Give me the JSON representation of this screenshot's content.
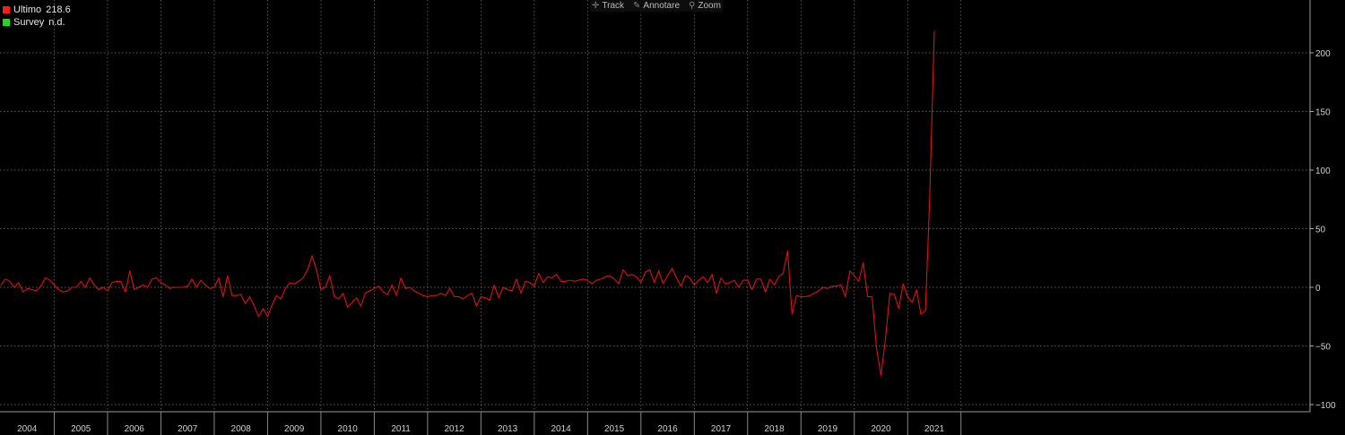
{
  "legend": [
    {
      "label": "Ultimo",
      "value": "218.6",
      "color": "#ff1a1a"
    },
    {
      "label": "Survey",
      "value": "n.d.",
      "color": "#18e018"
    }
  ],
  "toolbar": {
    "track": {
      "label": "Track",
      "icon": "crosshair-icon"
    },
    "annotate": {
      "label": "Annotare",
      "icon": "pencil-icon"
    },
    "zoom": {
      "label": "Zoom",
      "icon": "magnifier-icon"
    }
  },
  "chart_data": {
    "type": "line",
    "title": "",
    "xlabel": "",
    "ylabel": "",
    "x_start": "2004-01",
    "x_frequency": "monthly",
    "x_ticks": [
      "2004",
      "2005",
      "2006",
      "2007",
      "2008",
      "2009",
      "2010",
      "2011",
      "2012",
      "2013",
      "2014",
      "2015",
      "2016",
      "2017",
      "2018",
      "2019",
      "2020",
      "2021"
    ],
    "y_ticks": [
      200,
      150,
      100,
      50,
      0,
      -50,
      -100
    ],
    "ylim": [
      -105,
      242
    ],
    "grid": true,
    "legend_position": "top-left",
    "series": [
      {
        "name": "Ultimo",
        "color": "#e01010",
        "values": [
          2,
          7,
          5,
          0,
          4,
          -4,
          -1,
          -2,
          -3,
          1,
          8,
          6,
          2,
          -2,
          -4,
          -3,
          0,
          0,
          5,
          0,
          8,
          2,
          -2,
          0,
          -3,
          4,
          5,
          5,
          -4,
          14,
          -2,
          0,
          2,
          0,
          7,
          8,
          4,
          2,
          -1,
          0,
          0,
          0,
          1,
          7,
          0,
          6,
          2,
          -1,
          0,
          8,
          -8,
          10,
          -7,
          -7,
          -6,
          -14,
          -8,
          -16,
          -25,
          -18,
          -25,
          -15,
          -7,
          -10,
          -1,
          4,
          3,
          5,
          8,
          15,
          27,
          15,
          -2,
          0,
          10,
          -8,
          -10,
          -5,
          -17,
          -13,
          -9,
          -16,
          -5,
          -3,
          -1,
          1,
          -4,
          -6,
          2,
          -7,
          8,
          -1,
          0,
          -3,
          -5,
          -7,
          -8,
          -7,
          -7,
          -5,
          -7,
          -1,
          -8,
          -8,
          -10,
          -7,
          -5,
          -16,
          -8,
          -9,
          -11,
          2,
          -9,
          0,
          -2,
          -3,
          7,
          -5,
          5,
          4,
          1,
          12,
          4,
          9,
          8,
          11,
          5,
          5,
          6,
          5,
          6,
          7,
          6,
          3,
          6,
          7,
          9,
          10,
          7,
          3,
          15,
          10,
          11,
          9,
          4,
          13,
          15,
          4,
          14,
          3,
          10,
          16,
          8,
          1,
          10,
          8,
          2,
          6,
          9,
          4,
          11,
          -5,
          8,
          3,
          4,
          6,
          0,
          6,
          6,
          -2,
          7,
          7,
          -4,
          7,
          2,
          9,
          12,
          31,
          -23,
          -7,
          -8,
          -8,
          -7,
          -5,
          -3,
          0,
          -1,
          1,
          1,
          2,
          -8,
          14,
          10,
          5,
          21,
          -8,
          -8,
          -52,
          -75,
          -45,
          -5,
          -6,
          -18,
          3,
          -8,
          -13,
          -2,
          -23,
          -20,
          80,
          218.6
        ]
      }
    ]
  }
}
